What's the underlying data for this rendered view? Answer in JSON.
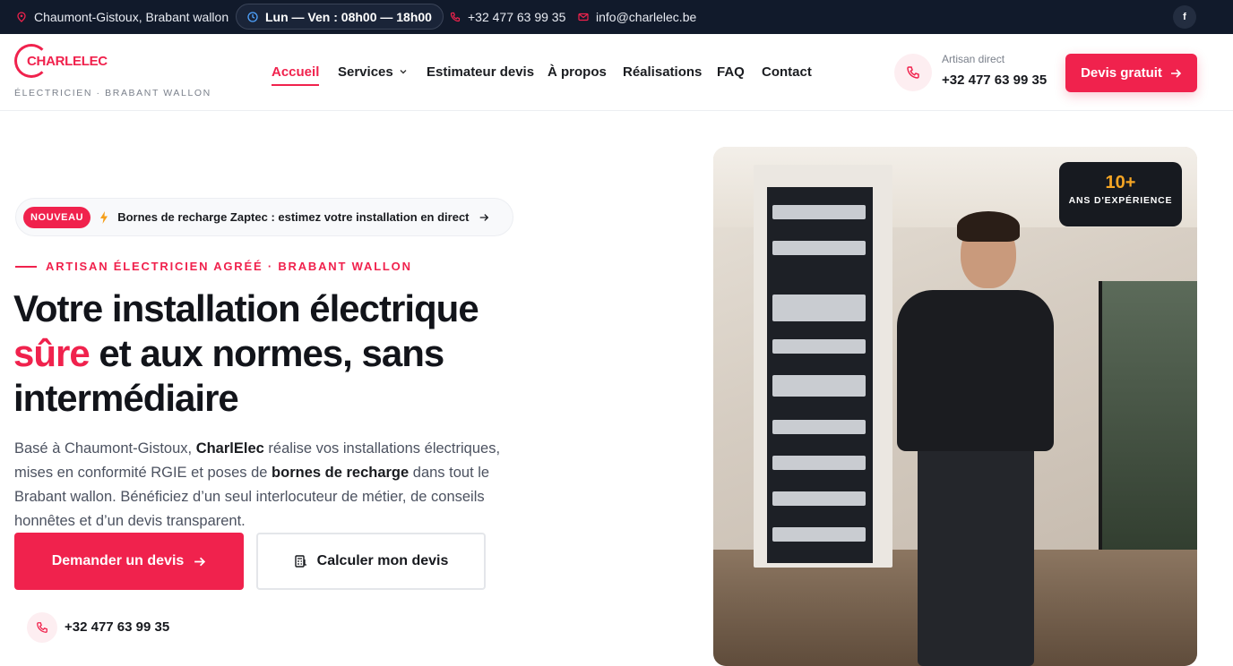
{
  "topbar": {
    "location": "Chaumont-Gistoux, Brabant wallon",
    "hours": "Lun — Ven : 08h00 — 18h00",
    "phone": "+32 477 63 99 35",
    "email": "info@charlelec.be",
    "social": "f"
  },
  "header": {
    "logo_prefix": "CHARL",
    "logo_suffix": "ELEC",
    "tagline": "ÉLECTRICIEN · BRABANT WALLON",
    "nav": [
      "Accueil",
      "Services",
      "Estimateur devis",
      "À propos",
      "Réalisations",
      "FAQ",
      "Contact"
    ],
    "phone_label": "Artisan direct",
    "phone": "+32 477 63 99 35",
    "cta": "Devis gratuit"
  },
  "hero": {
    "promo_badge": "NOUVEAU",
    "promo_text": "Bornes de recharge Zaptec : estimez votre installation en direct",
    "eyebrow": "ARTISAN ÉLECTRICIEN AGRÉÉ · BRABANT WALLON",
    "title_line1": "Votre installation électrique",
    "title_accent": "sûre",
    "title_line2_rest": " et aux normes, sans",
    "title_line3": "intermédiaire",
    "lead_part1": "Basé à Chaumont-Gistoux, ",
    "lead_bold1": "CharlElec",
    "lead_part2": " réalise vos installations électriques, mises en conformité RGIE et poses de ",
    "lead_bold2": "bornes de recharge",
    "lead_part3": " dans tout le Brabant wallon. Bénéficiez d’un seul interlocuteur de métier, de conseils honnêtes et d’un devis transparent.",
    "btn_primary": "Demander un devis",
    "btn_secondary": "Calculer mon devis",
    "phone": "+32 477 63 99 35",
    "experience_value": "10+",
    "experience_label": "ANS D'EXPÉRIENCE"
  },
  "colors": {
    "accent": "#f0224d",
    "topbar_bg": "#111a2b",
    "badge_gold": "#f5a524"
  },
  "icons": [
    "map-pin-icon",
    "clock-icon",
    "phone-icon",
    "mail-icon",
    "facebook-icon",
    "chevron-down-icon",
    "arrow-right-icon",
    "bolt-icon",
    "calculator-icon"
  ]
}
